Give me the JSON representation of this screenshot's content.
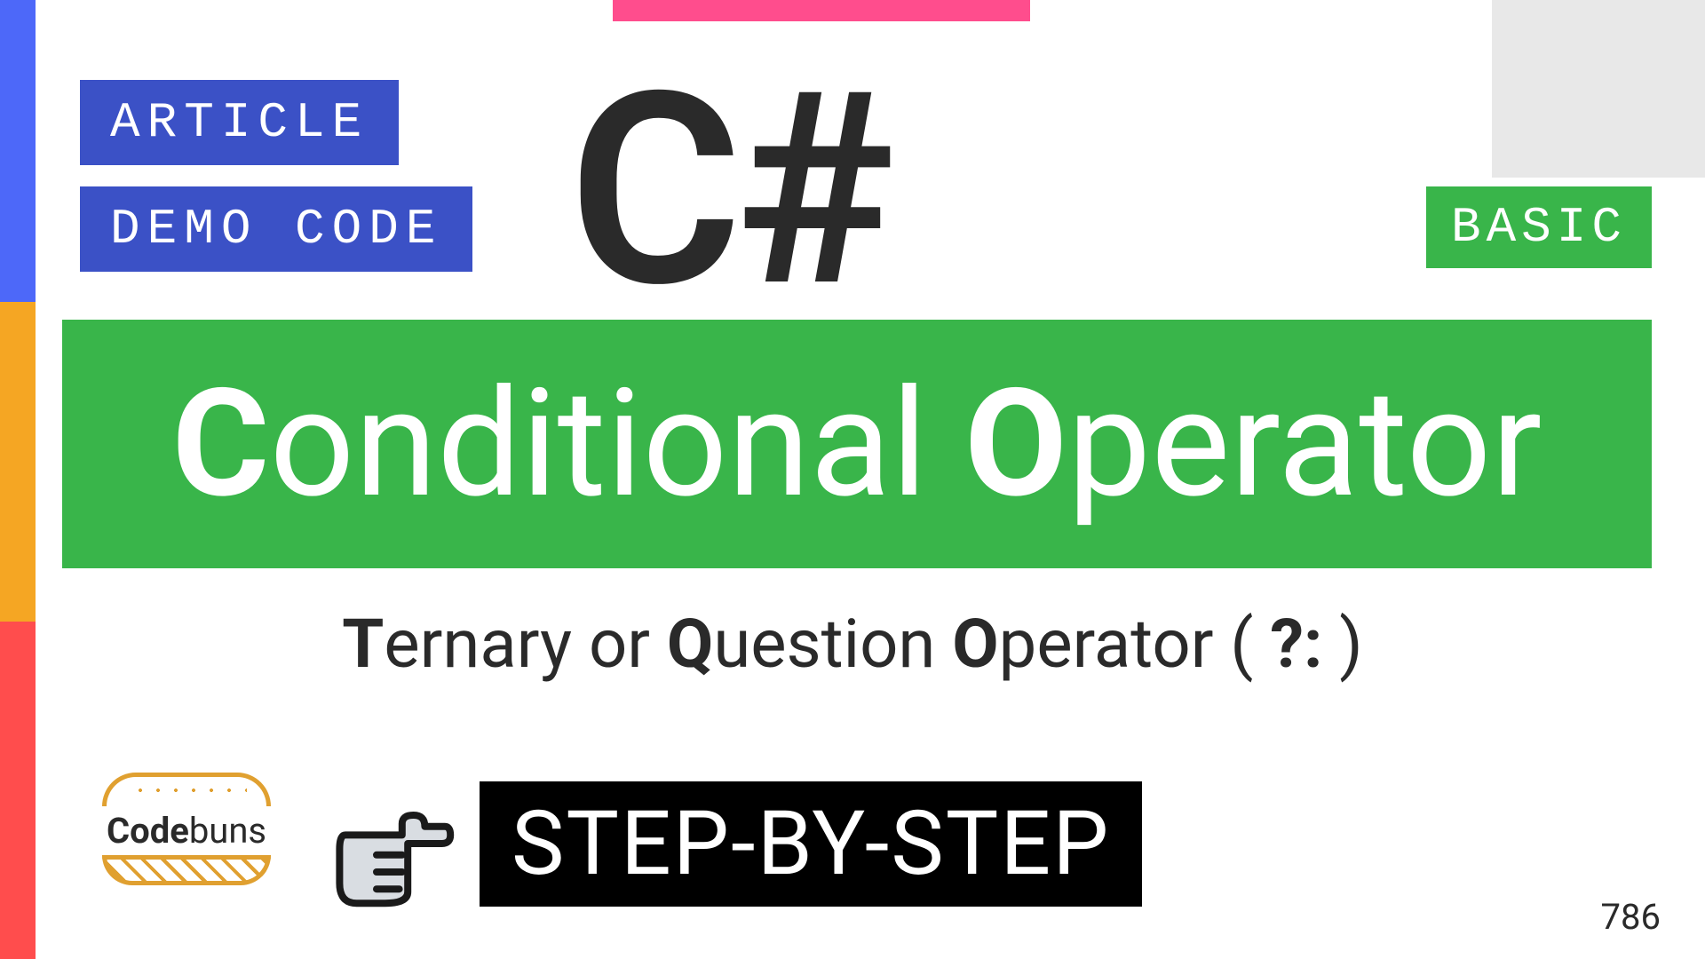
{
  "badges": {
    "article": "ARTICLE",
    "democode": "DEMO CODE",
    "basic": "BASIC"
  },
  "language": "C#",
  "title": {
    "c": "C",
    "onditional": "onditional ",
    "o": "O",
    "perator": "perator"
  },
  "subtitle": {
    "t": "T",
    "ernary_or": "ernary or ",
    "q": "Q",
    "uestion": "uestion ",
    "o": "O",
    "perator": "perator ( ",
    "sym": "?:",
    "close": " )"
  },
  "brand": {
    "code": "Code",
    "buns": "buns"
  },
  "step": "STEP-BY-STEP",
  "page": "786"
}
